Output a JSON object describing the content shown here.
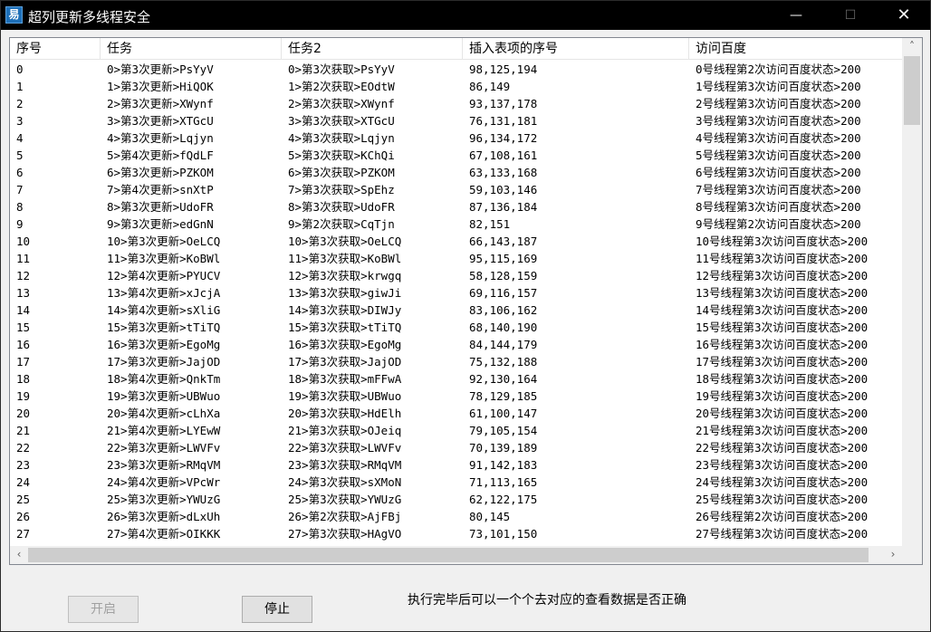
{
  "window": {
    "title": "超列更新多线程安全",
    "icon_char": "易",
    "controls": {
      "minimize": "—",
      "maximize": "☐",
      "close": "✕"
    }
  },
  "table": {
    "columns": [
      "序号",
      "任务",
      "任务2",
      "插入表项的序号",
      "访问百度"
    ],
    "rows": [
      [
        "0",
        "0>第3次更新>PsYyV",
        "0>第3次获取>PsYyV",
        "98,125,194",
        "0号线程第2次访问百度状态>200"
      ],
      [
        "1",
        "1>第3次更新>HiQOK",
        "1>第2次获取>EOdtW",
        "86,149",
        "1号线程第3次访问百度状态>200"
      ],
      [
        "2",
        "2>第3次更新>XWynf",
        "2>第3次获取>XWynf",
        "93,137,178",
        "2号线程第3次访问百度状态>200"
      ],
      [
        "3",
        "3>第3次更新>XTGcU",
        "3>第3次获取>XTGcU",
        "76,131,181",
        "3号线程第3次访问百度状态>200"
      ],
      [
        "4",
        "4>第3次更新>Lqjyn",
        "4>第3次获取>Lqjyn",
        "96,134,172",
        "4号线程第3次访问百度状态>200"
      ],
      [
        "5",
        "5>第4次更新>fQdLF",
        "5>第3次获取>KChQi",
        "67,108,161",
        "5号线程第3次访问百度状态>200"
      ],
      [
        "6",
        "6>第3次更新>PZKOM",
        "6>第3次获取>PZKOM",
        "63,133,168",
        "6号线程第3次访问百度状态>200"
      ],
      [
        "7",
        "7>第4次更新>snXtP",
        "7>第3次获取>SpEhz",
        "59,103,146",
        "7号线程第3次访问百度状态>200"
      ],
      [
        "8",
        "8>第3次更新>UdoFR",
        "8>第3次获取>UdoFR",
        "87,136,184",
        "8号线程第3次访问百度状态>200"
      ],
      [
        "9",
        "9>第3次更新>edGnN",
        "9>第2次获取>CqTjn",
        "82,151",
        "9号线程第2次访问百度状态>200"
      ],
      [
        "10",
        "10>第3次更新>OeLCQ",
        "10>第3次获取>OeLCQ",
        "66,143,187",
        "10号线程第3次访问百度状态>200"
      ],
      [
        "11",
        "11>第3次更新>KoBWl",
        "11>第3次获取>KoBWl",
        "95,115,169",
        "11号线程第3次访问百度状态>200"
      ],
      [
        "12",
        "12>第4次更新>PYUCV",
        "12>第3次获取>krwgq",
        "58,128,159",
        "12号线程第3次访问百度状态>200"
      ],
      [
        "13",
        "13>第4次更新>xJcjA",
        "13>第3次获取>giwJi",
        "69,116,157",
        "13号线程第3次访问百度状态>200"
      ],
      [
        "14",
        "14>第4次更新>sXliG",
        "14>第3次获取>DIWJy",
        "83,106,162",
        "14号线程第3次访问百度状态>200"
      ],
      [
        "15",
        "15>第3次更新>tTiTQ",
        "15>第3次获取>tTiTQ",
        "68,140,190",
        "15号线程第3次访问百度状态>200"
      ],
      [
        "16",
        "16>第3次更新>EgoMg",
        "16>第3次获取>EgoMg",
        "84,144,179",
        "16号线程第3次访问百度状态>200"
      ],
      [
        "17",
        "17>第3次更新>JajOD",
        "17>第3次获取>JajOD",
        "75,132,188",
        "17号线程第3次访问百度状态>200"
      ],
      [
        "18",
        "18>第4次更新>QnkTm",
        "18>第3次获取>mFFwA",
        "92,130,164",
        "18号线程第3次访问百度状态>200"
      ],
      [
        "19",
        "19>第3次更新>UBWuo",
        "19>第3次获取>UBWuo",
        "78,129,185",
        "19号线程第3次访问百度状态>200"
      ],
      [
        "20",
        "20>第4次更新>cLhXa",
        "20>第3次获取>HdElh",
        "61,100,147",
        "20号线程第3次访问百度状态>200"
      ],
      [
        "21",
        "21>第4次更新>LYEwW",
        "21>第3次获取>OJeiq",
        "79,105,154",
        "21号线程第3次访问百度状态>200"
      ],
      [
        "22",
        "22>第3次更新>LWVFv",
        "22>第3次获取>LWVFv",
        "70,139,189",
        "22号线程第3次访问百度状态>200"
      ],
      [
        "23",
        "23>第3次更新>RMqVM",
        "23>第3次获取>RMqVM",
        "91,142,183",
        "23号线程第3次访问百度状态>200"
      ],
      [
        "24",
        "24>第4次更新>VPcWr",
        "24>第3次获取>sXMoN",
        "71,113,165",
        "24号线程第3次访问百度状态>200"
      ],
      [
        "25",
        "25>第3次更新>YWUzG",
        "25>第3次获取>YWUzG",
        "62,122,175",
        "25号线程第3次访问百度状态>200"
      ],
      [
        "26",
        "26>第3次更新>dLxUh",
        "26>第2次获取>AjFBj",
        "80,145",
        "26号线程第2次访问百度状态>200"
      ],
      [
        "27",
        "27>第4次更新>OIKKK",
        "27>第3次获取>HAgVO",
        "73,101,150",
        "27号线程第3次访问百度状态>200"
      ]
    ]
  },
  "scrollbar_icons": {
    "up": "˄",
    "down": "˅",
    "left": "‹",
    "right": "›"
  },
  "buttons": {
    "start": "开启",
    "stop": "停止"
  },
  "status_text": "执行完毕后可以一个个去对应的查看数据是否正确"
}
